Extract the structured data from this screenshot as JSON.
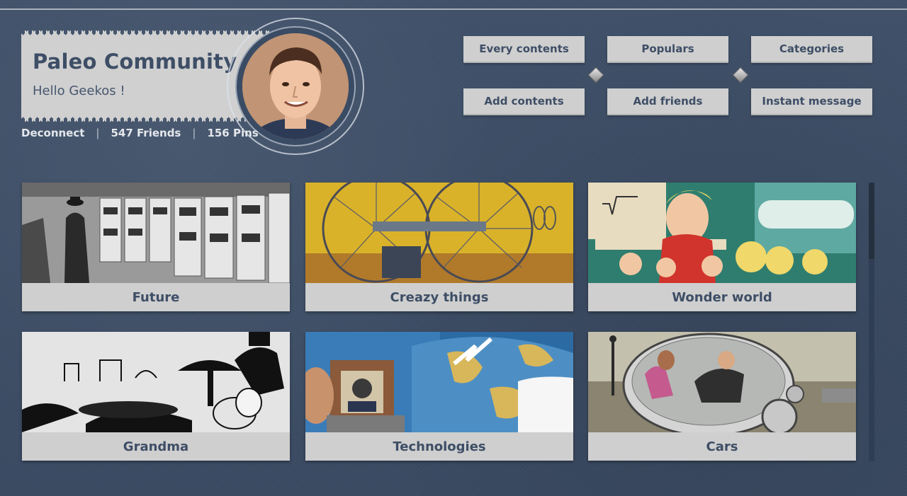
{
  "profile": {
    "name": "Paleo Community",
    "greeting": "Hello Geekos !",
    "links": {
      "deconnect": "Deconnect",
      "friends": "547 Friends",
      "pins": "156 Pins",
      "separator": "|"
    }
  },
  "nav": {
    "every_contents": "Every contents",
    "populars": "Populars",
    "categories": "Categories",
    "add_contents": "Add contents",
    "add_friends": "Add friends",
    "instant_message": "Instant message"
  },
  "categories": [
    {
      "label": "Future"
    },
    {
      "label": "Creazy things"
    },
    {
      "label": "Wonder world"
    },
    {
      "label": "Grandma"
    },
    {
      "label": "Technologies"
    },
    {
      "label": "Cars"
    }
  ],
  "colors": {
    "background": "#3c4d66",
    "panel": "#cfcfcf",
    "text_dark": "#3e4e66"
  }
}
